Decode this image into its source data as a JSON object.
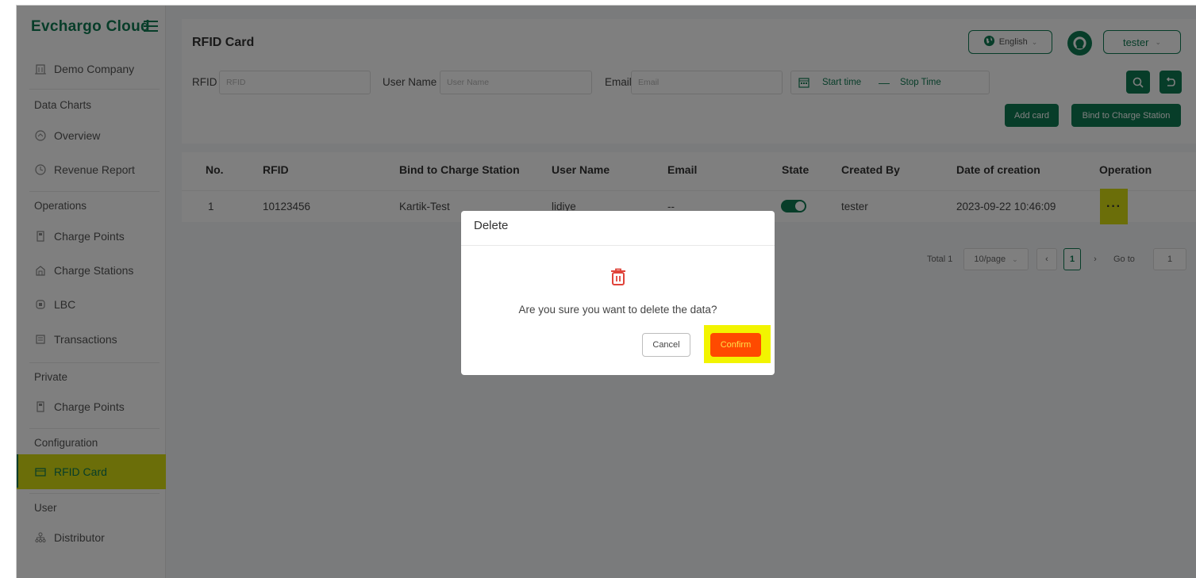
{
  "brand": {
    "name": "Evchargo Cloud"
  },
  "sidebar": {
    "company": "Demo Company",
    "sections": {
      "data_charts": "Data Charts",
      "operations": "Operations",
      "private": "Private",
      "configuration": "Configuration",
      "user": "User"
    },
    "items": {
      "overview": "Overview",
      "revenue_report": "Revenue Report",
      "charge_points": "Charge Points",
      "charge_stations": "Charge Stations",
      "lbc": "LBC",
      "transactions": "Transactions",
      "private_charge_points": "Charge Points",
      "rfid_card": "RFID Card",
      "distributor": "Distributor"
    }
  },
  "header": {
    "title": "RFID Card",
    "language": "English",
    "user": "tester"
  },
  "filters": {
    "rfid_label": "RFID",
    "rfid_placeholder": "RFID",
    "username_label": "User Name",
    "username_placeholder": "User Name",
    "email_label": "Email",
    "email_placeholder": "Email",
    "start_time": "Start time",
    "range_separator": "—",
    "stop_time": "Stop Time"
  },
  "actions": {
    "add_card": "Add card",
    "bind_station": "Bind to Charge Station"
  },
  "table": {
    "columns": {
      "no": "No.",
      "rfid": "RFID",
      "bind": "Bind to Charge Station",
      "username": "User Name",
      "email": "Email",
      "state": "State",
      "created_by": "Created By",
      "date": "Date of creation",
      "operation": "Operation"
    },
    "rows": [
      {
        "no": "1",
        "rfid": "10123456",
        "bind": "Kartik-Test",
        "username": "lidiye",
        "email": "--",
        "state_on": true,
        "created_by": "tester",
        "date": "2023-09-22 10:46:09",
        "operation": "···"
      }
    ]
  },
  "pagination": {
    "total": "Total 1",
    "page_size": "10/page",
    "current": "1",
    "goto_label": "Go to",
    "goto_value": "1"
  },
  "dialog": {
    "title": "Delete",
    "message": "Are you sure you want to delete the data?",
    "cancel": "Cancel",
    "confirm": "Confirm"
  },
  "colors": {
    "brand_green": "#0f7a52",
    "highlight": "#d7dd12",
    "confirm": "#ff4a00",
    "delete_icon": "#e0433a"
  },
  "icons": [
    "menu-icon",
    "building-icon",
    "dashboard-icon",
    "clock-icon",
    "charger-icon",
    "station-icon",
    "lbc-icon",
    "transactions-icon",
    "card-icon",
    "org-chart-icon",
    "globe-icon",
    "chevron-down-icon",
    "calendar-icon",
    "search-icon",
    "reset-icon",
    "trash-icon"
  ]
}
